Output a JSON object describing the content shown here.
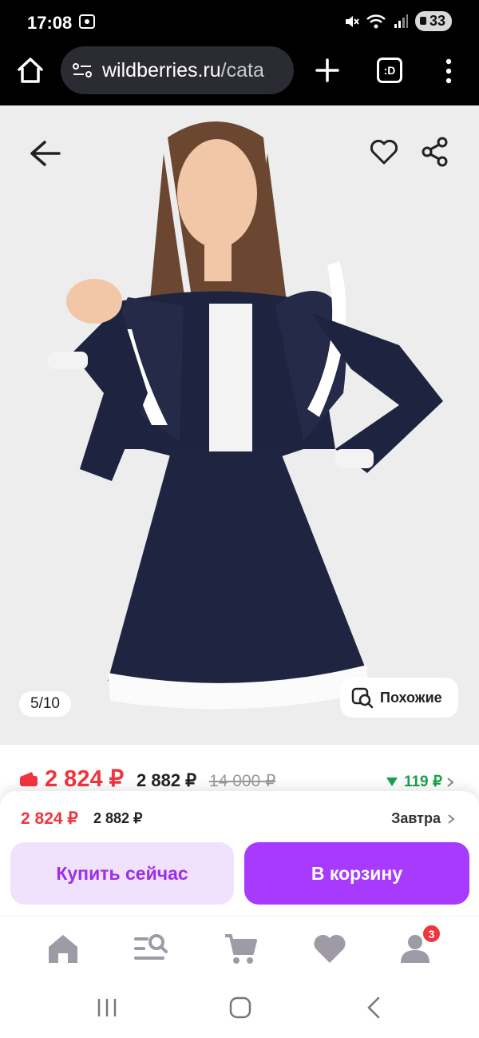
{
  "status_bar": {
    "time": "17:08",
    "battery": "33",
    "icons": [
      "screenshot-icon",
      "mute-icon",
      "wifi-icon",
      "signal-icon"
    ]
  },
  "browser": {
    "url_host": "wildberries.ru",
    "url_path": "/cata",
    "tabs_label": ":D"
  },
  "gallery": {
    "counter": "5/10",
    "similar_label": "Похожие"
  },
  "price": {
    "main": "2 824 ₽",
    "second": "2 882 ₽",
    "old": "14 000 ₽",
    "delta": "119 ₽"
  },
  "buy_panel": {
    "price": "2 824 ₽",
    "price_second": "2 882 ₽",
    "delivery": "Завтра",
    "buy_now_label": "Купить сейчас",
    "to_cart_label": "В корзину"
  },
  "bottom_nav": {
    "items": [
      "home-icon",
      "catalog-search-icon",
      "cart-icon",
      "favorites-icon",
      "profile-icon"
    ],
    "profile_badge": "3"
  },
  "colors": {
    "price_red": "#f0353f",
    "accent_purple": "#a73afd",
    "accent_light": "#f0e1fc",
    "delta_green": "#17a34a"
  }
}
